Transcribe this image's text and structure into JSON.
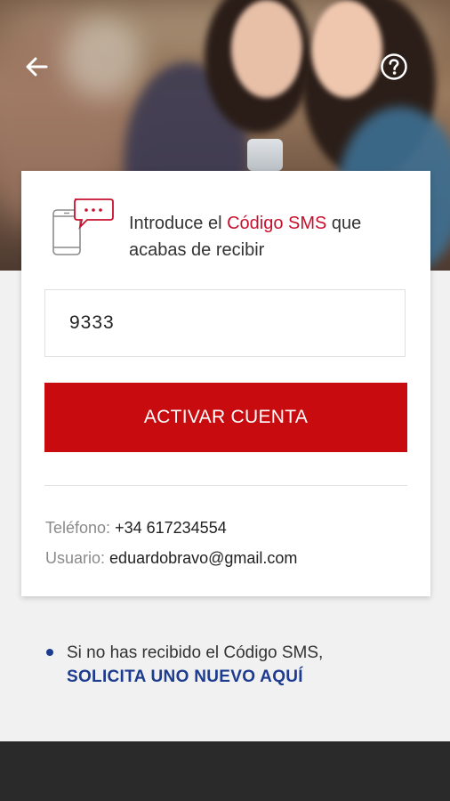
{
  "hero": {
    "back_icon": "arrow-left-icon",
    "help_icon": "question-circle-icon"
  },
  "card": {
    "intro_prefix": "Introduce el ",
    "intro_highlight": "Código SMS",
    "intro_suffix": " que acabas de recibir",
    "highlight_color": "#c8102e",
    "icon": "sms-phone-icon",
    "code_value": "9333",
    "activate_label": "ACTIVAR CUENTA",
    "button_color": "#c70b0e",
    "phone_label": "Teléfono:",
    "phone_value": "+34 617234554",
    "user_label": "Usuario:",
    "user_value": "eduardobravo@gmail.com"
  },
  "resend": {
    "text": "Si no has recibido el Código SMS,",
    "link": "SOLICITA UNO NUEVO AQUÍ",
    "link_color": "#1d3c8f"
  }
}
